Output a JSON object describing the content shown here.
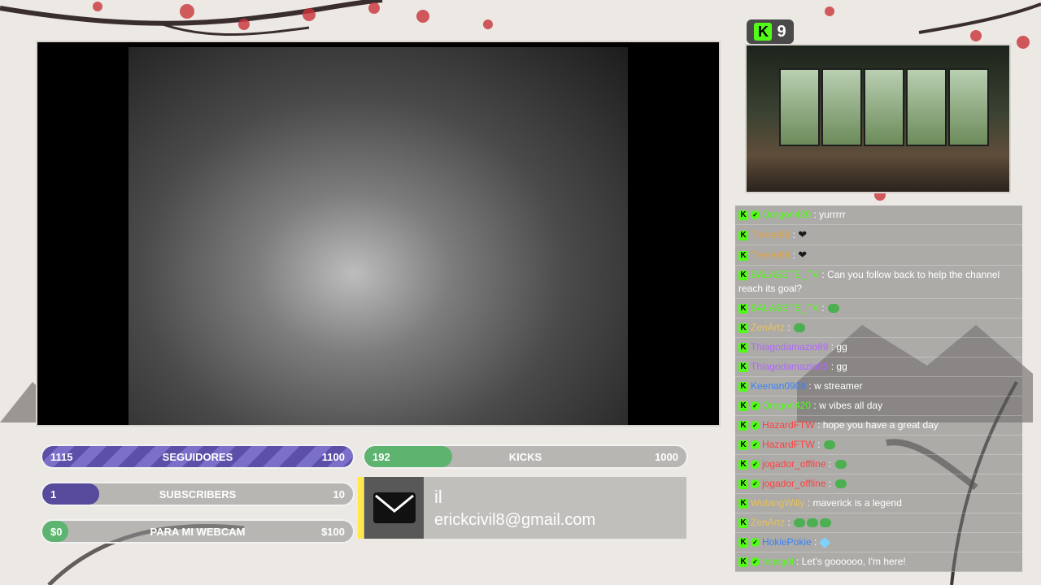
{
  "kick_count": {
    "icon": "kick-logo-icon",
    "value": "9"
  },
  "goals": [
    {
      "current": "1115",
      "label": "SEGUIDORES",
      "target": "1100",
      "progress": 1.0
    },
    {
      "current": "1",
      "label": "SUBSCRIBERS",
      "target": "10",
      "progress": 0.1
    },
    {
      "current": "$0",
      "label": "PARA MI WEBCAM",
      "target": "$100",
      "progress": 0.0
    },
    {
      "current": "192",
      "label": "KICKS",
      "target": "1000",
      "progress": 0.192
    }
  ],
  "mail": {
    "title": "il",
    "text": "erickcivil8@gmail.com"
  },
  "chat": [
    {
      "user": "Oregon420",
      "color": "#53fc18",
      "verified": true,
      "message": "yurrrrr"
    },
    {
      "user": "Trener99",
      "color": "#e8a23a",
      "verified": false,
      "message": "",
      "emote": "heart"
    },
    {
      "user": "Trener99",
      "color": "#e8a23a",
      "verified": false,
      "message": "",
      "emote": "heart"
    },
    {
      "user": "BALASETE_TV",
      "color": "#53fc18",
      "verified": false,
      "message": "Can you follow back to help the channel reach its goal?"
    },
    {
      "user": "BALASETE_TV",
      "color": "#53fc18",
      "verified": false,
      "message": "",
      "emote": "frog"
    },
    {
      "user": "ZenArtz",
      "color": "#e8c15a",
      "verified": false,
      "message": "",
      "emote": "frog"
    },
    {
      "user": "Thiagodamazio89",
      "color": "#b266ff",
      "verified": false,
      "message": "gg"
    },
    {
      "user": "Thiagodamazio89",
      "color": "#b266ff",
      "verified": false,
      "message": "gg"
    },
    {
      "user": "Keenan0908",
      "color": "#3b82f6",
      "verified": false,
      "message": "w streamer"
    },
    {
      "user": "Oregon420",
      "color": "#53fc18",
      "verified": true,
      "message": "w vibes all day"
    },
    {
      "user": "HazardFTW",
      "color": "#ff4040",
      "verified": true,
      "message": "hope you have a great day"
    },
    {
      "user": "HazardFTW",
      "color": "#ff4040",
      "verified": true,
      "message": "",
      "emote": "frog"
    },
    {
      "user": "jogador_offline",
      "color": "#ff4040",
      "verified": true,
      "message": "",
      "emote": "frog"
    },
    {
      "user": "jogador_offline",
      "color": "#ff4040",
      "verified": true,
      "message": "",
      "emote": "frog"
    },
    {
      "user": "WutangWilly",
      "color": "#e8c15a",
      "verified": false,
      "message": "maverick is a legend"
    },
    {
      "user": "ZenArtz",
      "color": "#e8c15a",
      "verified": false,
      "message": "",
      "emote": "frog3"
    },
    {
      "user": "HokiePokie",
      "color": "#3b82f6",
      "verified": true,
      "message": "",
      "emote": "gem"
    },
    {
      "user": "teusgol",
      "color": "#53fc18",
      "verified": true,
      "message": "Let's goooooo, I'm here!"
    }
  ],
  "colors": {
    "kick_green": "#53fc18",
    "goal_purple": "#574a9c",
    "goal_green": "#5db46f",
    "mail_accent": "#ffe94a"
  }
}
